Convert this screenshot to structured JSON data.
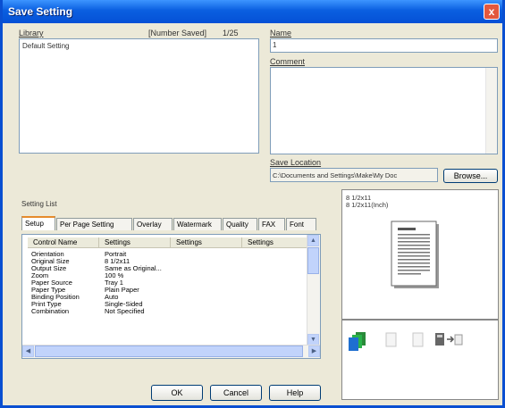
{
  "window": {
    "title": "Save Setting",
    "close_glyph": "x"
  },
  "library": {
    "label": "Library",
    "number_saved_label": "[Number Saved]",
    "count": "1/25",
    "items": [
      "Default Setting"
    ]
  },
  "name": {
    "label": "Name",
    "value": "1"
  },
  "comment": {
    "label": "Comment",
    "value": ""
  },
  "save_location": {
    "label": "Save Location",
    "value": "C:\\Documents and Settings\\Make\\My Doc",
    "browse_label": "Browse..."
  },
  "setting_list": {
    "label": "Setting List",
    "tabs": [
      "Setup",
      "Per Page Setting",
      "Overlay",
      "Watermark",
      "Quality",
      "FAX",
      "Font"
    ],
    "active_tab": "Setup",
    "columns": [
      "Control Name",
      "Settings",
      "Settings",
      "Settings"
    ],
    "rows": [
      {
        "name": "Orientation",
        "value": "Portrait"
      },
      {
        "name": "Original Size",
        "value": "8 1/2x11"
      },
      {
        "name": "Output Size",
        "value": "Same as Original..."
      },
      {
        "name": "Zoom",
        "value": "100 %"
      },
      {
        "name": "Paper Source",
        "value": "Tray 1"
      },
      {
        "name": "Paper Type",
        "value": "Plain Paper"
      },
      {
        "name": "Binding Position",
        "value": "Auto"
      },
      {
        "name": "Print Type",
        "value": "Single-Sided"
      },
      {
        "name": "Combination",
        "value": "Not Specified"
      }
    ]
  },
  "preview": {
    "lines": [
      "8 1/2x11",
      "8 1/2x11(Inch)"
    ]
  },
  "buttons": {
    "ok": "OK",
    "cancel": "Cancel",
    "help": "Help"
  },
  "status_icons": [
    "stacked-pages-icon",
    "single-page-icon",
    "duplex-page-icon",
    "printer-output-icon"
  ]
}
